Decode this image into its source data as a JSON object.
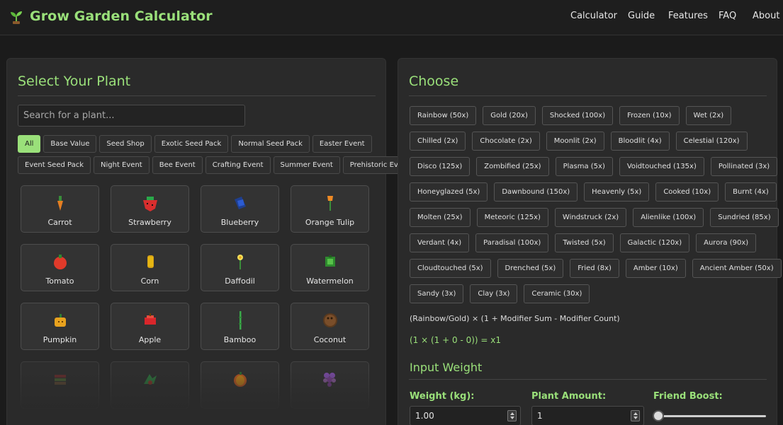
{
  "header": {
    "title": "Grow Garden Calculator",
    "nav": [
      "Calculator",
      "Guide",
      "Features",
      "FAQ",
      "About"
    ]
  },
  "left": {
    "title": "Select Your Plant",
    "search_placeholder": "Search for a plant...",
    "filters_row1": [
      "All",
      "Base Value",
      "Seed Shop",
      "Exotic Seed Pack",
      "Normal Seed Pack",
      "Easter Event"
    ],
    "filters_row2": [
      "Event Seed Pack",
      "Night Event",
      "Bee Event",
      "Crafting Event",
      "Summer Event",
      "Prehistoric Event"
    ],
    "plants": [
      [
        "Carrot",
        "Strawberry",
        "Blueberry",
        "Orange Tulip"
      ],
      [
        "Tomato",
        "Corn",
        "Daffodil",
        "Watermelon"
      ],
      [
        "Pumpkin",
        "Apple",
        "Bamboo",
        "Coconut"
      ]
    ]
  },
  "right": {
    "title": "Choose",
    "modifier_rows": [
      [
        "Rainbow (50x)",
        "Gold (20x)",
        "Shocked (100x)",
        "Frozen (10x)",
        "Wet (2x)"
      ],
      [
        "Chilled (2x)",
        "Chocolate (2x)",
        "Moonlit (2x)",
        "Bloodlit (4x)",
        "Celestial (120x)"
      ],
      [
        "Disco (125x)",
        "Zombified (25x)",
        "Plasma (5x)",
        "Voidtouched (135x)",
        "Pollinated (3x)"
      ],
      [
        "Honeyglazed (5x)",
        "Dawnbound (150x)",
        "Heavenly (5x)",
        "Cooked (10x)",
        "Burnt (4x)"
      ],
      [
        "Molten (25x)",
        "Meteoric (125x)",
        "Windstruck (2x)",
        "Alienlike (100x)",
        "Sundried (85x)"
      ],
      [
        "Verdant (4x)",
        "Paradisal (100x)",
        "Twisted (5x)",
        "Galactic (120x)",
        "Aurora (90x)"
      ],
      [
        "Cloudtouched (5x)",
        "Drenched (5x)",
        "Fried (8x)",
        "Amber (10x)",
        "Ancient Amber (50x)"
      ],
      [
        "Sandy (3x)",
        "Clay (3x)",
        "Ceramic (30x)"
      ]
    ],
    "formula": "(Rainbow/Gold) × (1 + Modifier Sum - Modifier Count)",
    "result": "(1 × (1 + 0 - 0)) = x1",
    "input_title": "Input Weight",
    "weight_label": "Weight (kg):",
    "weight_value": "1.00",
    "amount_label": "Plant Amount:",
    "amount_value": "1",
    "friend_label": "Friend Boost:",
    "friend_boost_level": 0
  }
}
